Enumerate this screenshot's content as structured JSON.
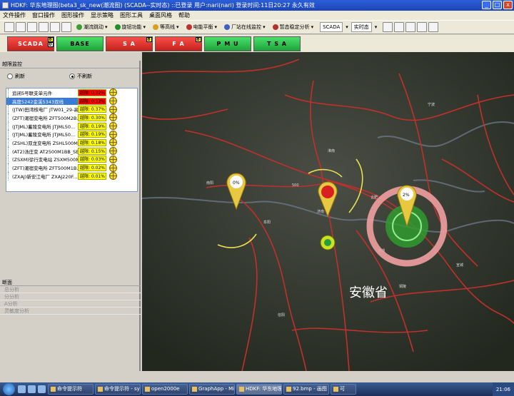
{
  "window": {
    "title": "HDKF: 华东地理图(beta3_sk_new(潮流图) (SCADA--实时态) ::已登录  用户:nari(nari)  登录时间:11日20:27  永久有效"
  },
  "menu": [
    "文件操作",
    "窗口操作",
    "图形操作",
    "显示策略",
    "图形工具",
    "桌面风格",
    "帮助"
  ],
  "toolbar": {
    "items": [
      {
        "label": "潮流跳动"
      },
      {
        "label": "旋钮功能"
      },
      {
        "label": "等高线"
      },
      {
        "label": "电能平衡"
      },
      {
        "label": "厂站在线监控"
      },
      {
        "label": "暂态稳定分析"
      }
    ],
    "context": "SCADA",
    "state": "实时态"
  },
  "modes": [
    {
      "label": "SCADA",
      "color": "red",
      "badges": [
        "8",
        "0"
      ]
    },
    {
      "label": "BASE",
      "color": "green",
      "badges": []
    },
    {
      "label": "S A",
      "color": "red",
      "badges": [
        "8"
      ]
    },
    {
      "label": "F A",
      "color": "red",
      "badges": [
        "8"
      ]
    },
    {
      "label": "P M U",
      "color": "green",
      "badges": []
    },
    {
      "label": "T S A",
      "color": "green",
      "badges": []
    }
  ],
  "left": {
    "title": "越限监控",
    "radio_refresh": "刷新",
    "radio_norefresh": "不刷新",
    "rows": [
      {
        "text": "追闭5号联支单元件",
        "limit": "越限: 0.32%",
        "red": true,
        "sel": false
      },
      {
        "text": "高度5242金溪5343双线",
        "limit": "越限: 0.32%",
        "red": true,
        "sel": true
      },
      {
        "text": "(JTW)田湾核电厂  JTW01_29-高",
        "limit": "越限: 0.37%",
        "red": false,
        "sel": false
      },
      {
        "text": "(ZFT)潮宿变电所  ZFT500M2B...",
        "limit": "越限: 0.30%",
        "red": false,
        "sel": false
      },
      {
        "text": "(JTJML)蓄陵变电所  JTJML50...",
        "limit": "越限: 0.19%",
        "red": false,
        "sel": false
      },
      {
        "text": "(JTJML)蓄陵变电所  JTJML50...",
        "limit": "越限: 0.19%",
        "red": false,
        "sel": false
      },
      {
        "text": "(ZSHL)双龙变电所  ZSHL500M...",
        "limit": "越限: 0.18%",
        "red": false,
        "sel": false
      },
      {
        "text": "(AT2)汤庄变  AT2500M1BB_SE...",
        "limit": "越限: 0.15%",
        "red": false,
        "sel": false
      },
      {
        "text": "(ZSXM)徐行变电站  ZSXM500M...",
        "limit": "越限: 0.03%",
        "red": false,
        "sel": false
      },
      {
        "text": "(ZFT)潮宿变电所  ZFT500M1B...",
        "limit": "越限: 0.02%",
        "red": false,
        "sel": false
      },
      {
        "text": "(ZXAJ)新安江电厂  ZXAJ220F...",
        "limit": "越限: 0.01%",
        "red": false,
        "sel": false
      }
    ],
    "section": "断面",
    "items": [
      "总分析",
      "分分析",
      "A分析",
      "灵敏度分析"
    ]
  },
  "map": {
    "province": "安徽省",
    "markers": [
      "0%",
      "2%",
      "??%"
    ]
  },
  "taskbar": {
    "tasks": [
      "命令提示符",
      "命令提示符 - sync...",
      "open2000e",
      "GraphApp - Microso...",
      "HDKF: 华东地理图...",
      "92.bmp - 画图",
      "可"
    ],
    "time": "21:06"
  }
}
